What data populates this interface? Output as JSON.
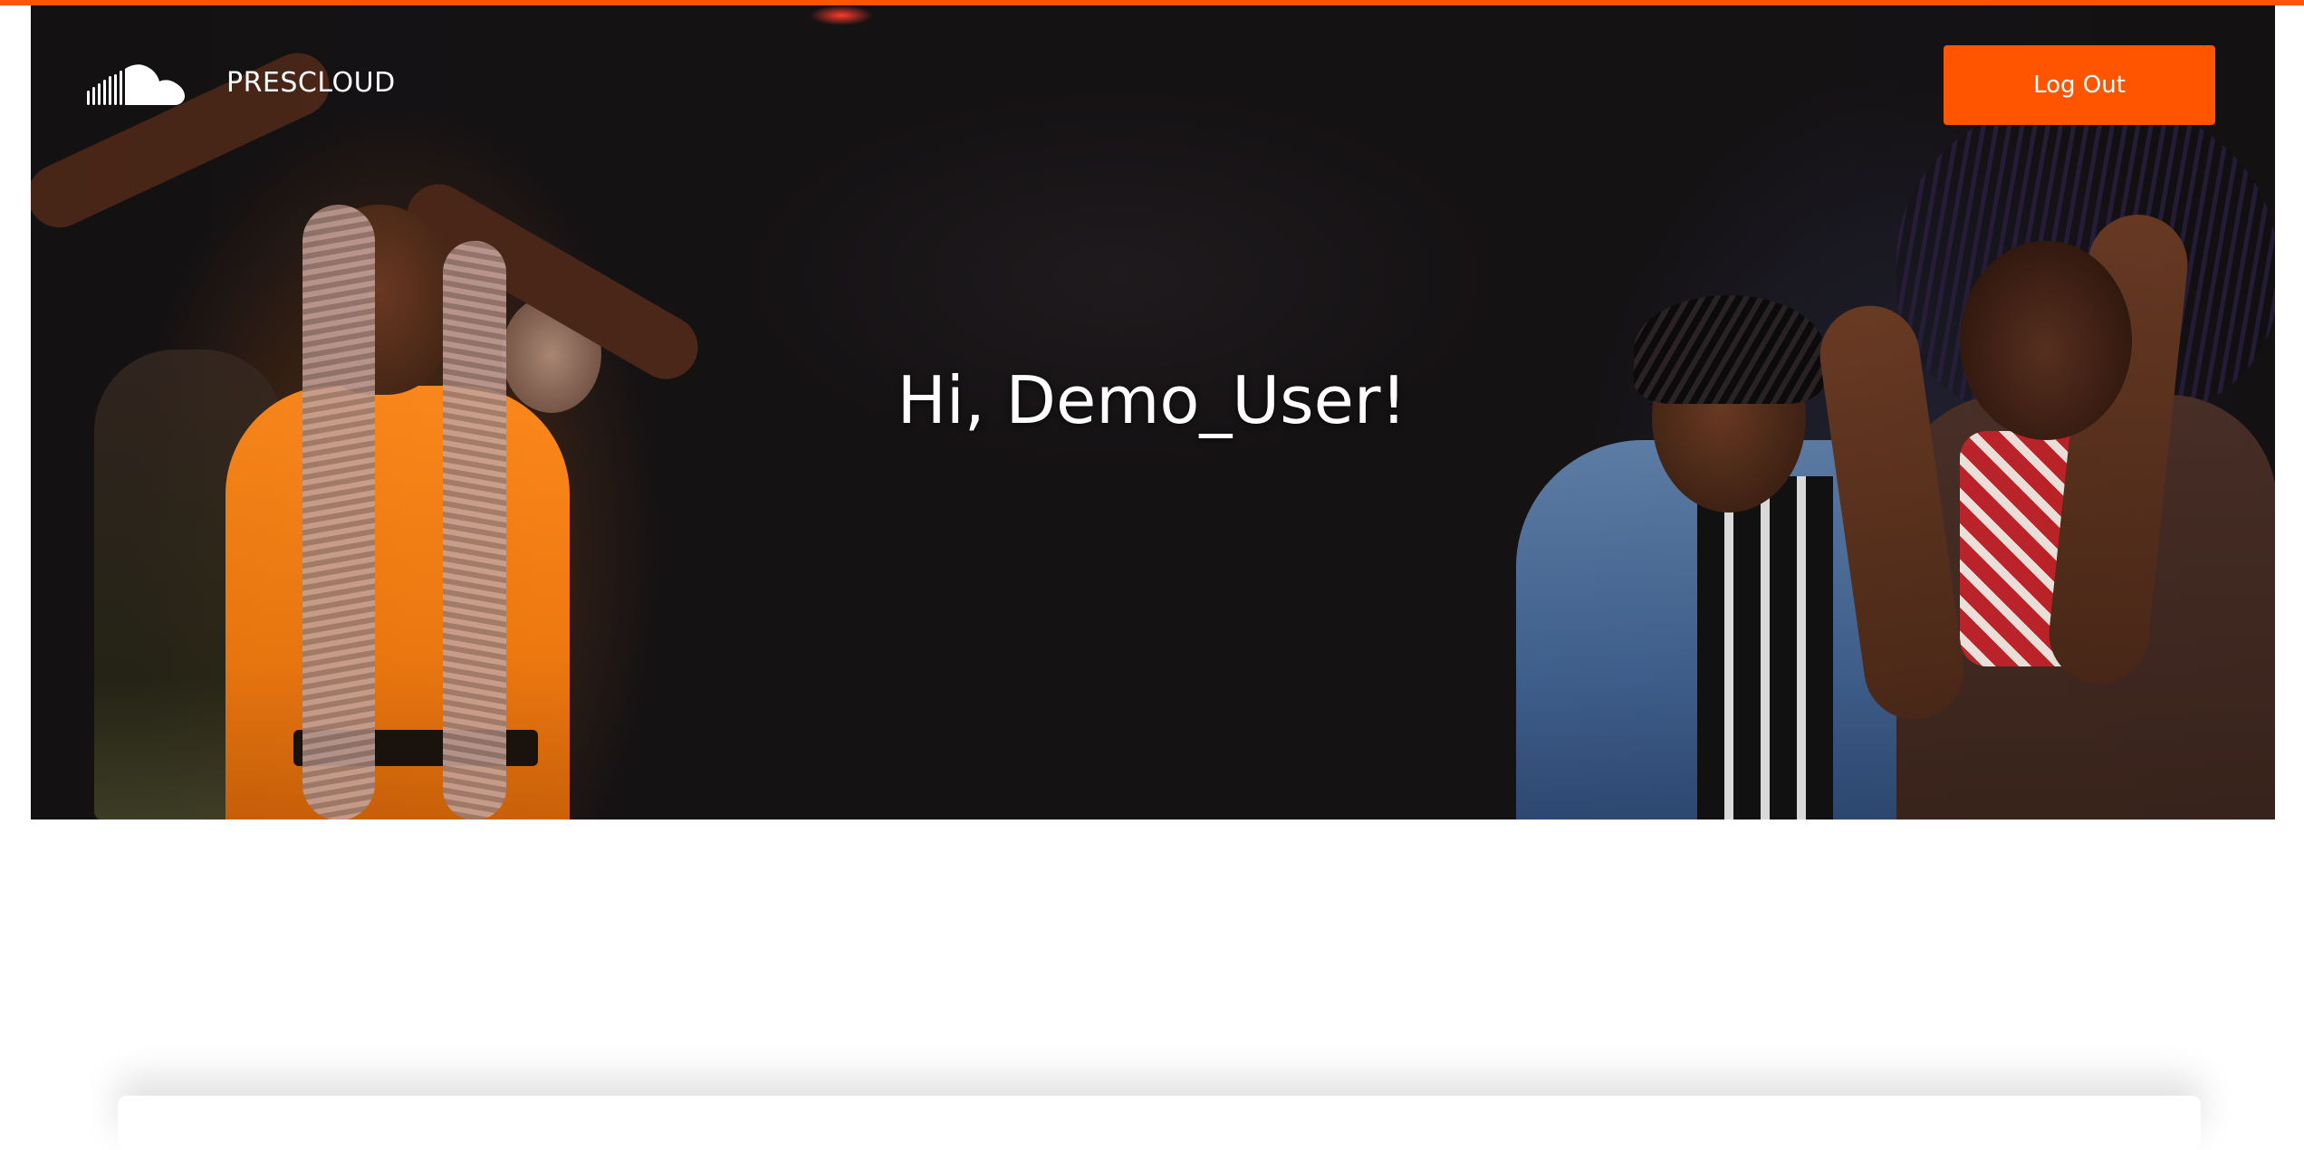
{
  "colors": {
    "accent": "#ff5500",
    "hero_background": "#141113",
    "text_on_hero": "#ffffff"
  },
  "nav": {
    "logo_icon": "soundcloud-cloud-icon",
    "brand": "PRESCLOUD",
    "logout_label": "Log Out"
  },
  "hero": {
    "greeting": "Hi, Demo_User!"
  }
}
